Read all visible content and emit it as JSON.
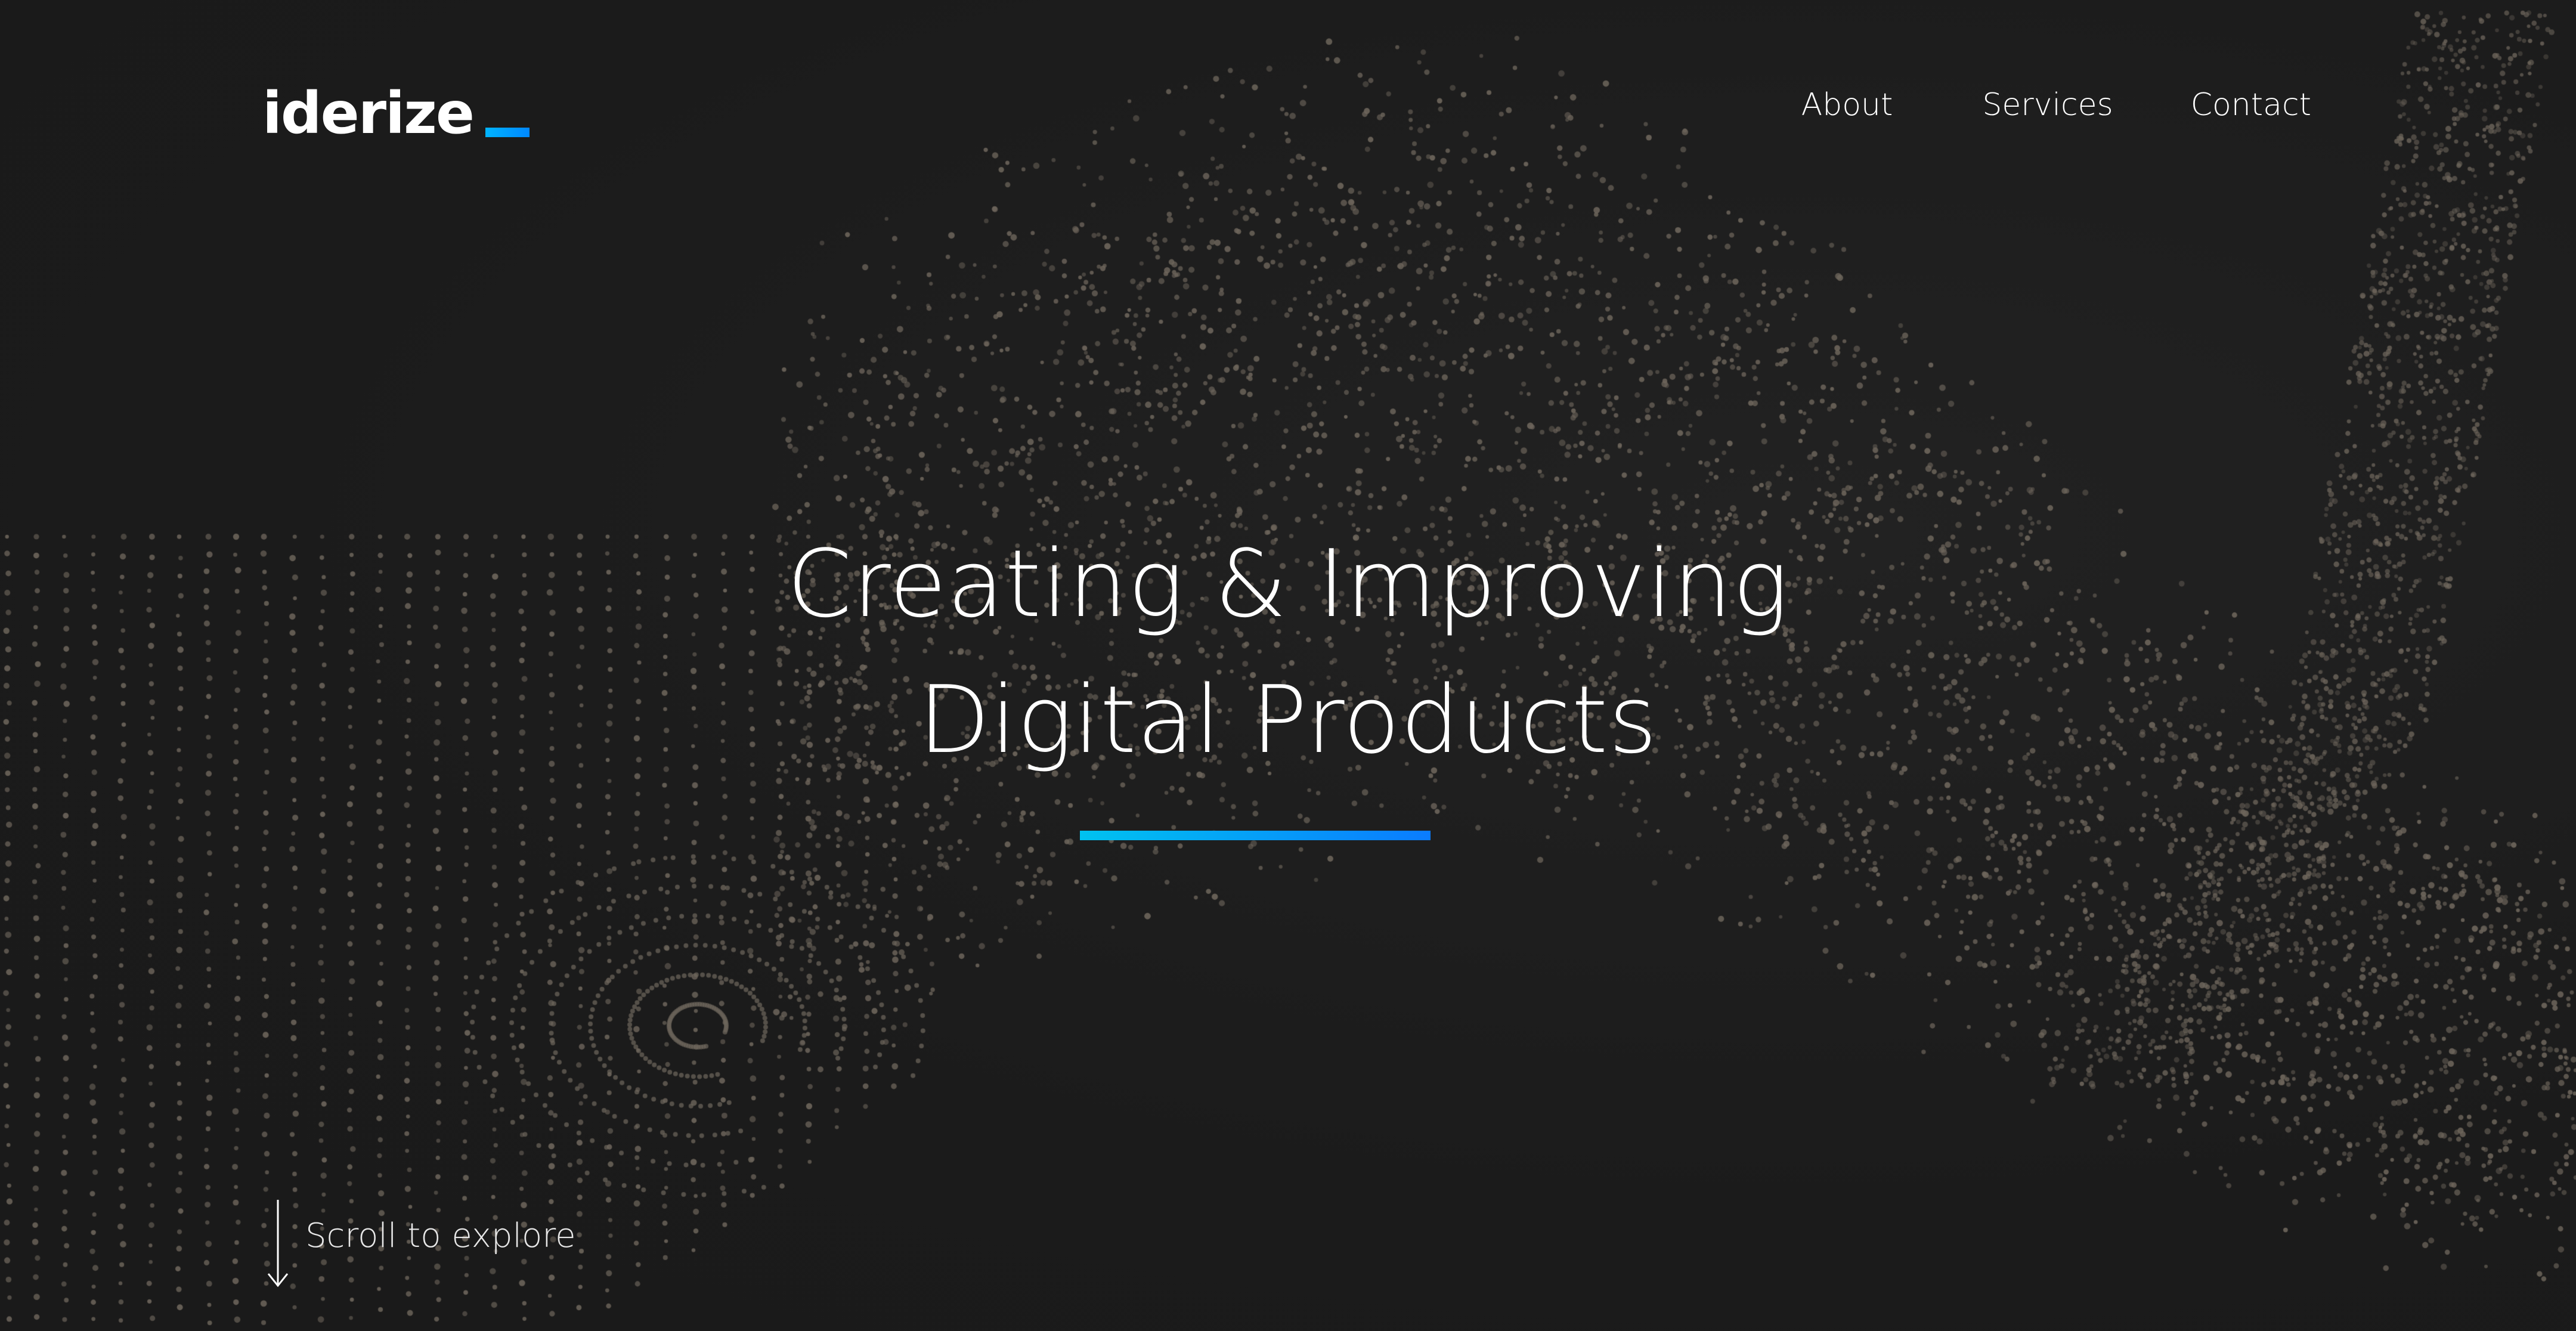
{
  "brand": {
    "logo_text": "iderize",
    "accent_color": "#0a9cff"
  },
  "nav": {
    "items": [
      {
        "label": "About"
      },
      {
        "label": "Services"
      },
      {
        "label": "Contact"
      }
    ]
  },
  "hero": {
    "line1": "Creating & Improving",
    "line2": "Digital Products"
  },
  "scroll": {
    "label": "Scroll to explore",
    "icon": "arrow-down-icon"
  },
  "colors": {
    "background": "#1c1c1c",
    "particles": "#6e665c",
    "text": "#ffffff",
    "underline_start": "#00c2f0",
    "underline_end": "#0a7cff"
  }
}
